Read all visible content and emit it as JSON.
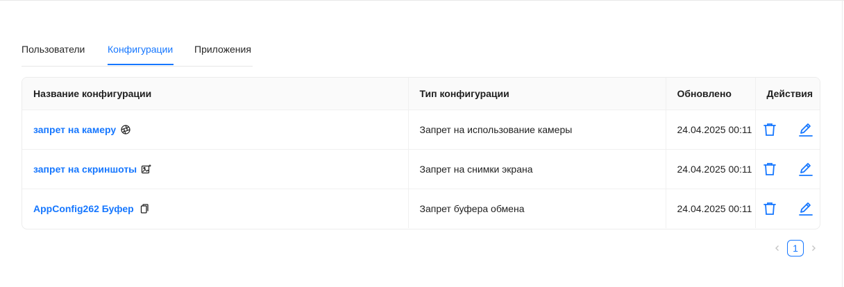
{
  "tabs": [
    {
      "label": "Пользователи",
      "active": false
    },
    {
      "label": "Конфигурации",
      "active": true
    },
    {
      "label": "Приложения",
      "active": false
    }
  ],
  "table": {
    "columns": {
      "name": "Название конфигурации",
      "type": "Тип конфигурации",
      "updated": "Обновлено",
      "actions": "Действия"
    },
    "rows": [
      {
        "name": "запрет на камеру",
        "icon": "camera-shutter-icon",
        "type": "Запрет на использование камеры",
        "updated": "24.04.2025 00:11"
      },
      {
        "name": "запрет на скриншоты",
        "icon": "screenshot-icon",
        "type": "Запрет на снимки экрана",
        "updated": "24.04.2025 00:11"
      },
      {
        "name": "AppConfig262 Буфер",
        "icon": "clipboard-copy-icon",
        "type": "Запрет буфера обмена",
        "updated": "24.04.2025 00:11"
      }
    ]
  },
  "pagination": {
    "current": "1"
  },
  "colors": {
    "accent": "#1677ff",
    "header_bg": "#fafafa",
    "border": "#f0f0f0"
  }
}
